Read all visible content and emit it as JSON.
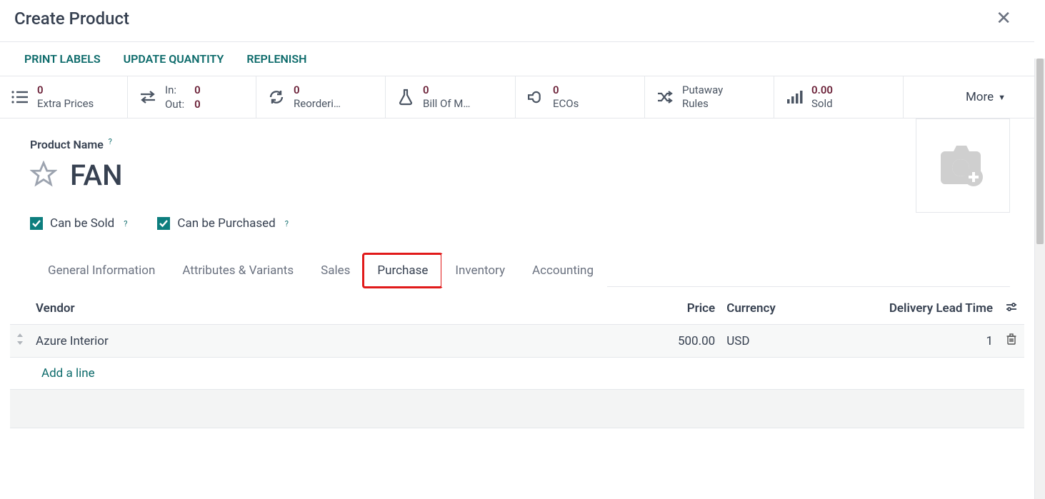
{
  "header": {
    "title": "Create Product"
  },
  "actions": {
    "print_labels": "PRINT LABELS",
    "update_quantity": "UPDATE QUANTITY",
    "replenish": "REPLENISH"
  },
  "stats": {
    "extra_prices": {
      "num": "0",
      "label": "Extra Prices"
    },
    "in_label": "In:",
    "in_val": "0",
    "out_label": "Out:",
    "out_val": "0",
    "reordering": {
      "num": "0",
      "label": "Reorderi…"
    },
    "bom": {
      "num": "0",
      "label": "Bill Of M…"
    },
    "ecos": {
      "num": "0",
      "label": "ECOs"
    },
    "putaway": {
      "line1": "Putaway",
      "line2": "Rules"
    },
    "sold": {
      "num": "0.00",
      "label": "Sold"
    },
    "more": "More"
  },
  "form": {
    "product_name_label": "Product Name",
    "product_name_value": "FAN",
    "can_be_sold": "Can be Sold",
    "can_be_purchased": "Can be Purchased"
  },
  "tabs": {
    "general": "General Information",
    "attributes": "Attributes & Variants",
    "sales": "Sales",
    "purchase": "Purchase",
    "inventory": "Inventory",
    "accounting": "Accounting"
  },
  "table": {
    "headers": {
      "vendor": "Vendor",
      "price": "Price",
      "currency": "Currency",
      "dlt": "Delivery Lead Time"
    },
    "rows": [
      {
        "vendor": "Azure Interior",
        "price": "500.00",
        "currency": "USD",
        "dlt": "1"
      }
    ],
    "add_line": "Add a line"
  }
}
